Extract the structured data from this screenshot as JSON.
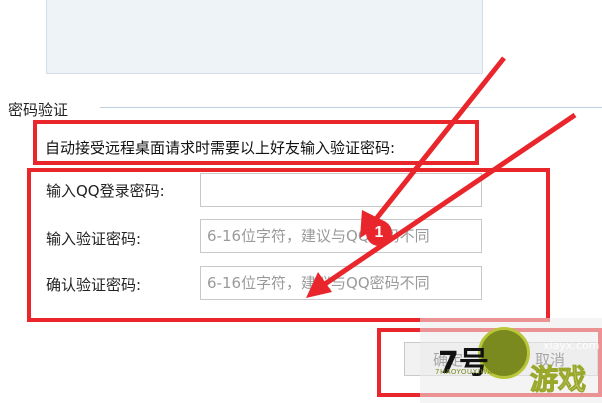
{
  "section": {
    "title": "密码验证",
    "description": "自动接受远程桌面请求时需要以上好友输入验证密码:"
  },
  "form": {
    "qq_password": {
      "label": "输入QQ登录密码:",
      "value": "",
      "placeholder": ""
    },
    "verify_password": {
      "label": "输入验证密码:",
      "placeholder": "6-16位字符，建议与QQ密码不同"
    },
    "confirm_password": {
      "label": "确认验证密码:",
      "placeholder": "6-16位字符，建议与QQ密码不同"
    }
  },
  "annotation": {
    "step_number": "1",
    "highlight_color": "#e8262c"
  },
  "buttons": {
    "ok_label": "确定",
    "cancel_label": "取消"
  },
  "watermark": {
    "brand": "游戏",
    "number": "7号",
    "url": "xiayx.com",
    "pinyin": "7HAOYOUXIWANG"
  }
}
